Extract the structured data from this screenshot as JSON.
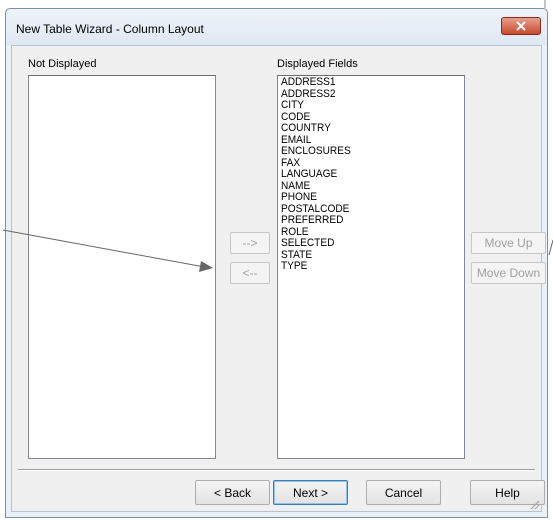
{
  "window": {
    "title": "New Table Wizard - Column Layout"
  },
  "not_displayed": {
    "label": "Not Displayed",
    "items": []
  },
  "displayed_fields": {
    "label": "Displayed Fields",
    "items": [
      "ADDRESS1",
      "ADDRESS2",
      "CITY",
      "CODE",
      "COUNTRY",
      "EMAIL",
      "ENCLOSURES",
      "FAX",
      "LANGUAGE",
      "NAME",
      "PHONE",
      "POSTALCODE",
      "PREFERRED",
      "ROLE",
      "SELECTED",
      "STATE",
      "TYPE"
    ]
  },
  "move_buttons": {
    "add_label": "-->",
    "remove_label": "<--"
  },
  "order_buttons": {
    "move_up_label": "Move Up",
    "move_down_label": "Move Down"
  },
  "footer": {
    "back_label": "< Back",
    "next_label": "Next >",
    "cancel_label": "Cancel",
    "help_label": "Help"
  },
  "colors": {
    "close_button": "#c64a2f",
    "frame": "#eaf0f8",
    "client": "#f0f0f0"
  }
}
